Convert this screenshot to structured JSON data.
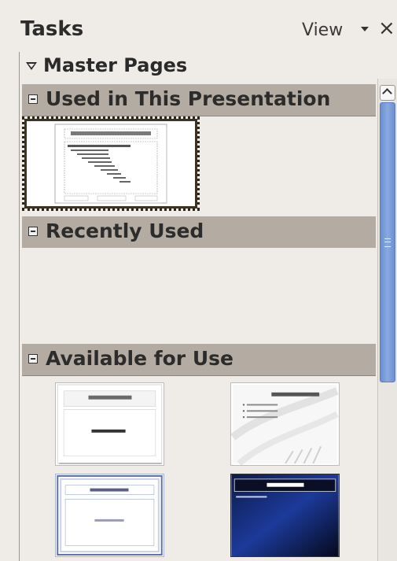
{
  "header": {
    "title": "Tasks",
    "view_label": "View",
    "close_glyph": "×"
  },
  "master_pages": {
    "label": "Master Pages"
  },
  "sections": {
    "used": {
      "label": "Used in This Presentation"
    },
    "recent": {
      "label": "Recently Used"
    },
    "available": {
      "label": "Available for Use"
    }
  },
  "thumbnails": {
    "used_default": {
      "title": "Click to edit the title text format",
      "selected": true
    },
    "available_1": {
      "title": "Click to add title",
      "body": "Click to add text"
    },
    "available_2": {
      "title": "Click to add title",
      "bullets": [
        "Click to add an outline",
        "Click to add an outline",
        "Click to add an outline"
      ]
    },
    "available_3": {
      "title": "Click to add title",
      "body": "Click to add text"
    },
    "available_4": {
      "title": "Click to add title",
      "bullets": [
        "Click to add an outline"
      ]
    }
  },
  "colors": {
    "section_header": "#b4aca2",
    "panel_bg": "#efebe7",
    "scroll_thumb": "#7c9cd8"
  }
}
